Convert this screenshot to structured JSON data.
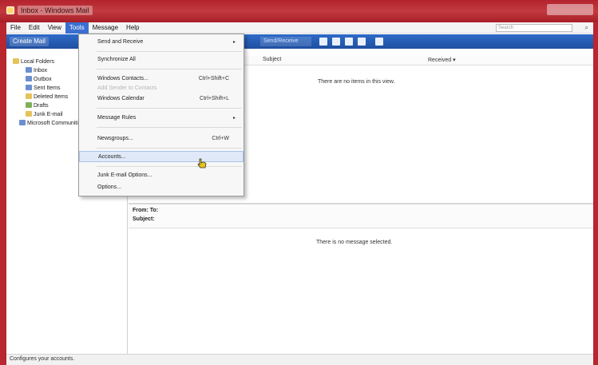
{
  "window": {
    "title": "Inbox - Windows Mail"
  },
  "menubar": {
    "items": [
      "File",
      "Edit",
      "View",
      "Tools",
      "Message",
      "Help"
    ],
    "active": "Tools",
    "search_placeholder": "Search"
  },
  "toolbar": {
    "create_label": "Create Mail",
    "find_label": "Send/Receive"
  },
  "folders": [
    {
      "label": "Local Folders"
    },
    {
      "label": "Inbox"
    },
    {
      "label": "Outbox"
    },
    {
      "label": "Sent Items"
    },
    {
      "label": "Deleted Items"
    },
    {
      "label": "Drafts"
    },
    {
      "label": "Junk E-mail"
    },
    {
      "label": "Microsoft Communities"
    }
  ],
  "list": {
    "col_subject": "Subject",
    "col_received": "Received",
    "sort_glyph": "▾",
    "empty_text": "There are no items in this view."
  },
  "preview": {
    "from_to": "From:  To:",
    "subject": "Subject:",
    "empty_text": "There is no message selected."
  },
  "status": {
    "text": "Configures your accounts."
  },
  "tools_menu": {
    "items": [
      {
        "label": "Send and Receive",
        "submenu": "▸"
      },
      {
        "label": "Synchronize All"
      },
      {
        "label": "Windows Contacts...",
        "shortcut": "Ctrl+Shift+C"
      },
      {
        "label": "Add Sender to Contacts",
        "disabled": true
      },
      {
        "label": "Windows Calendar",
        "shortcut": "Ctrl+Shift+L"
      },
      {
        "label": "Message Rules",
        "submenu": "▸"
      },
      {
        "label": "Newsgroups...",
        "shortcut": "Ctrl+W"
      },
      {
        "label": "Accounts...",
        "hover": true
      },
      {
        "label": "Junk E-mail Options..."
      },
      {
        "label": "Options..."
      }
    ]
  },
  "colors": {
    "titlebar": "#b8262f",
    "toolbar": "#2f6bc8",
    "menu_active": "#3b6fd1"
  }
}
